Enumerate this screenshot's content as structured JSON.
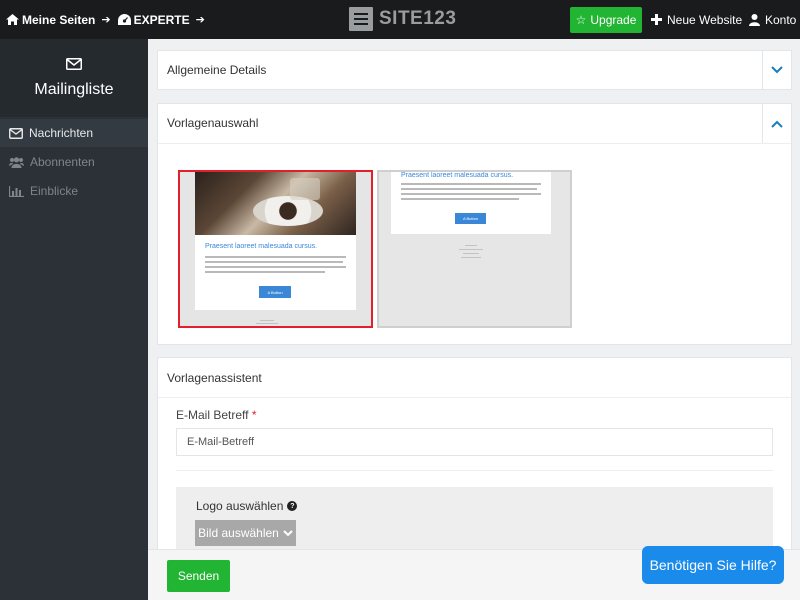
{
  "topbar": {
    "breadcrumbs": [
      "Meine Seiten",
      "EXPERTE"
    ],
    "logo_text": "SITE123",
    "upgrade_label": "Upgrade",
    "new_site_label": "Neue Website",
    "account_label": "Konto",
    "accent_green": "#21b533"
  },
  "sidebar": {
    "title": "Mailingliste",
    "items": [
      {
        "label": "Nachrichten",
        "icon": "envelope-icon",
        "active": true
      },
      {
        "label": "Abonnenten",
        "icon": "users-icon",
        "active": false
      },
      {
        "label": "Einblicke",
        "icon": "bar-chart-icon",
        "active": false
      }
    ]
  },
  "panels": {
    "general": {
      "title": "Allgemeine Details",
      "expanded": false
    },
    "templates": {
      "title": "Vorlagenauswahl",
      "expanded": true
    },
    "wizard": {
      "title": "Vorlagenassistent"
    }
  },
  "templates": [
    {
      "heading": "Praesent laoreet malesuada cursus.",
      "button_text": "A Button",
      "selected": true,
      "selected_color": "#e2202b"
    },
    {
      "heading": "Praesent laoreet malesuada cursus.",
      "button_text": "A Button",
      "selected": false
    }
  ],
  "form": {
    "subject_label": "E-Mail Betreff",
    "required_mark": "*",
    "subject_value": "E-Mail-Betreff",
    "logo_label": "Logo auswählen",
    "pick_image_label": "Bild auswählen"
  },
  "footer": {
    "send_label": "Senden",
    "help_label": "Benötigen Sie Hilfe?",
    "help_color": "#1a8bea"
  }
}
